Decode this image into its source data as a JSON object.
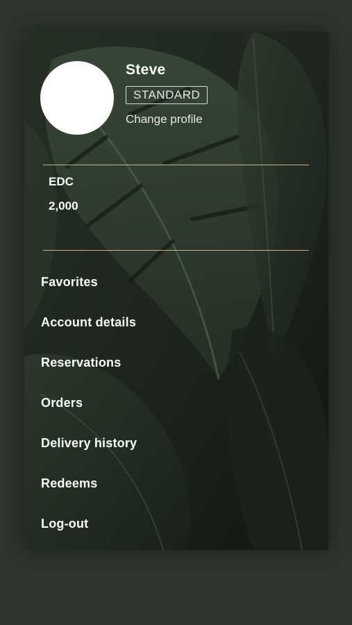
{
  "profile": {
    "name": "Steve",
    "tier": "STANDARD",
    "change_profile_label": "Change profile"
  },
  "balance": {
    "label": "EDC",
    "value": "2,000"
  },
  "menu": {
    "items": [
      {
        "label": "Favorites"
      },
      {
        "label": "Account details"
      },
      {
        "label": "Reservations"
      },
      {
        "label": "Orders"
      },
      {
        "label": "Delivery history"
      },
      {
        "label": "Redeems"
      },
      {
        "label": "Log-out"
      }
    ]
  },
  "colors": {
    "page_background": "#2e352e",
    "divider": "#c9b28a",
    "text": "#ffffff"
  }
}
